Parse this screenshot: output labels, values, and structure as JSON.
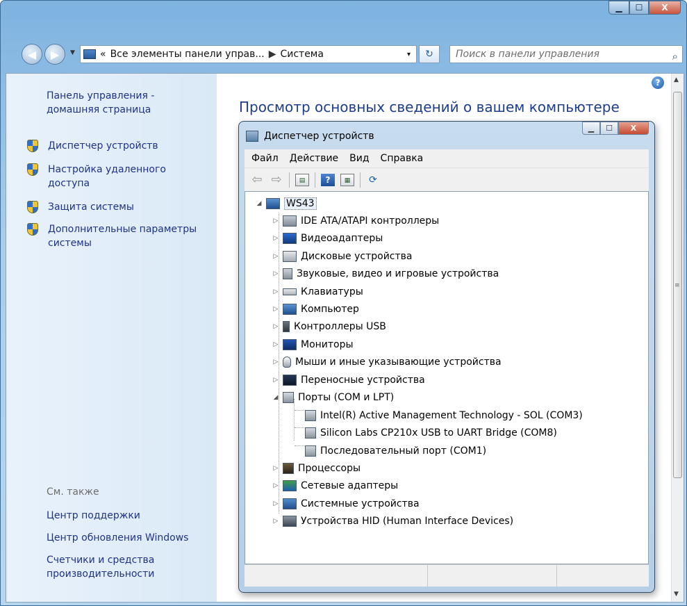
{
  "window": {
    "controls": {
      "minimize": "▁",
      "maximize": "☐",
      "close": "X"
    }
  },
  "address_bar": {
    "prefix": "«",
    "path_parent": "Все элементы панели управ...",
    "separator": "▶",
    "path_current": "Система",
    "dropdown": "▾",
    "refresh": "↻",
    "search_placeholder": "Поиск в панели управления",
    "search_icon": "⌕"
  },
  "left_pane": {
    "home_link": "Панель управления - домашняя страница",
    "tasks": [
      {
        "label": "Диспетчер устройств",
        "icon": "uac-shield-icon"
      },
      {
        "label": "Настройка удаленного доступа",
        "icon": "uac-shield-icon"
      },
      {
        "label": "Защита системы",
        "icon": "uac-shield-icon"
      },
      {
        "label": "Дополнительные параметры системы",
        "icon": "uac-shield-icon"
      }
    ],
    "see_also_header": "См. также",
    "see_also": [
      "Центр поддержки",
      "Центр обновления Windows",
      "Счетчики и средства производительности"
    ]
  },
  "main": {
    "title": "Просмотр основных сведений о вашем компьютере",
    "help": "?"
  },
  "device_manager": {
    "title": "Диспетчер устройств",
    "controls": {
      "minimize": "▁",
      "maximize": "☐",
      "close": "X"
    },
    "menu": [
      "Файл",
      "Действие",
      "Вид",
      "Справка"
    ],
    "root": "WS43",
    "categories": [
      "IDE ATA/ATAPI контроллеры",
      "Видеоадаптеры",
      "Дисковые устройства",
      "Звуковые, видео и игровые устройства",
      "Клавиатуры",
      "Компьютер",
      "Контроллеры USB",
      "Мониторы",
      "Мыши и иные указывающие устройства",
      "Переносные устройства",
      "Порты (COM и LPT)",
      "Процессоры",
      "Сетевые адаптеры",
      "Системные устройства",
      "Устройства HID (Human Interface Devices)"
    ],
    "ports_children": [
      "Intel(R) Active Management Technology - SOL (COM3)",
      "Silicon Labs CP210x USB to UART Bridge (COM8)",
      "Последовательный порт (COM1)"
    ],
    "expanded_glyph": "◢",
    "collapsed_glyph": "▷"
  }
}
